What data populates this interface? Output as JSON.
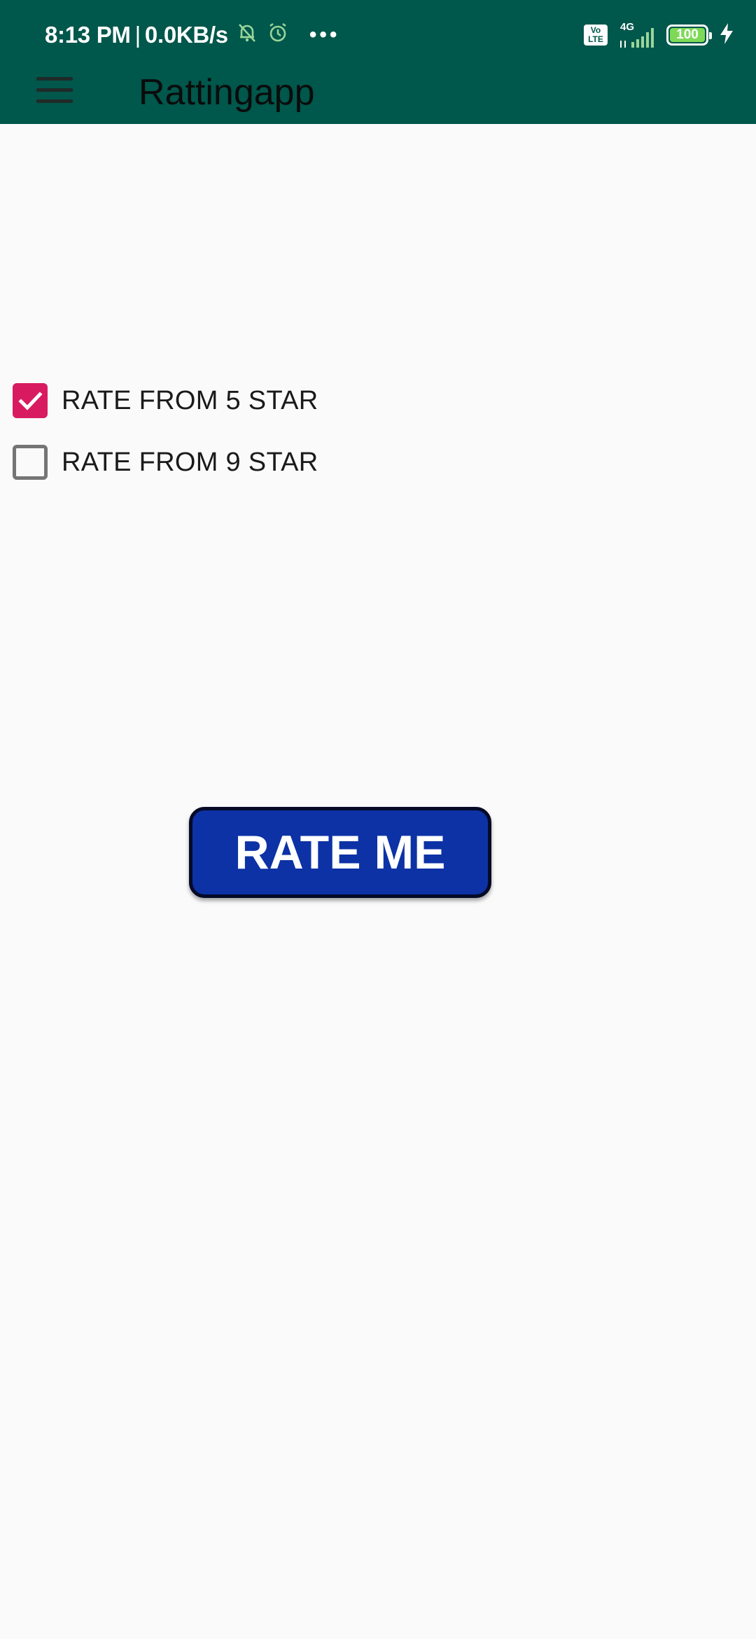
{
  "status_bar": {
    "time": "8:13 PM",
    "separator": "|",
    "speed": "0.0KB/s",
    "icons": [
      "muted-bell-icon",
      "alarm-icon",
      "more-dots-icon"
    ],
    "volte_line1": "Vo",
    "volte_line2": "LTE",
    "network": "4G",
    "battery_level": "100",
    "right_icons": [
      "volte-icon",
      "signal-icon",
      "battery-icon",
      "charging-icon"
    ]
  },
  "toolbar": {
    "menu_icon": "hamburger-menu-icon",
    "title": "Rattingapp"
  },
  "options": [
    {
      "label": "RATE FROM 5 STAR",
      "checked": true
    },
    {
      "label": "RATE FROM 9 STAR",
      "checked": false
    }
  ],
  "rate_button": {
    "label": "RATE ME"
  },
  "colors": {
    "app_bar": "#00574b",
    "checkbox_accent": "#d81b60",
    "button_fill": "#0d32a6",
    "background": "#fafafa"
  }
}
